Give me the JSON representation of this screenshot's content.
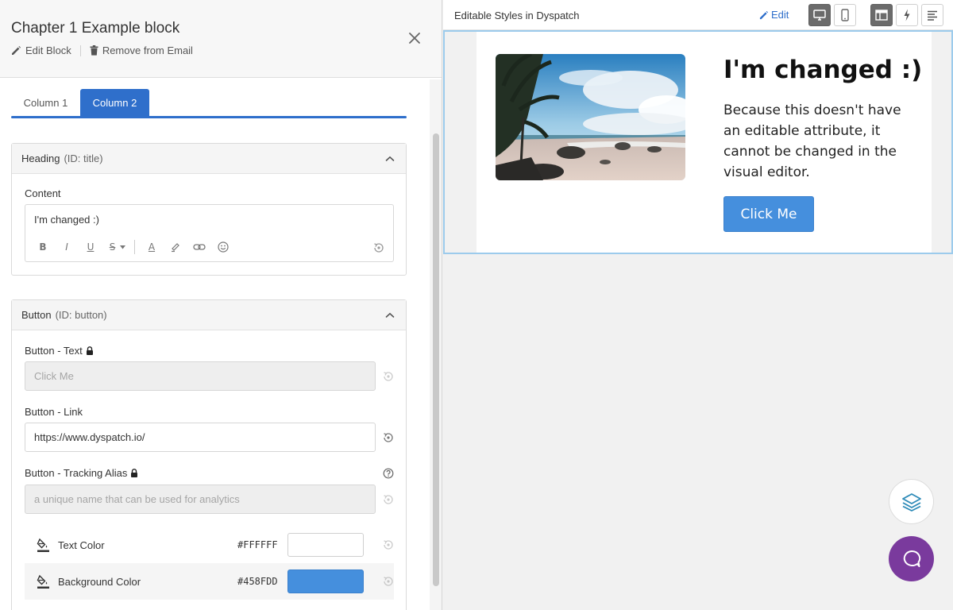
{
  "editor": {
    "title": "Chapter 1 Example block",
    "edit_block_label": "Edit Block",
    "remove_label": "Remove from Email",
    "tabs": [
      {
        "label": "Column 1",
        "active": false
      },
      {
        "label": "Column 2",
        "active": true
      }
    ],
    "heading_section": {
      "title": "Heading",
      "id_label": "(ID: title)",
      "content_label": "Content",
      "content_value": "I'm changed :)",
      "toolbar": {
        "bold": "B",
        "italic": "I",
        "underline": "U",
        "strike": "S",
        "font_color": "A"
      }
    },
    "button_section": {
      "title": "Button",
      "id_label": "(ID: button)",
      "text_label": "Button - Text",
      "text_placeholder": "Click Me",
      "link_label": "Button - Link",
      "link_value": "https://www.dyspatch.io/",
      "tracking_label": "Button - Tracking Alias",
      "tracking_placeholder": "a unique name that can be used for analytics",
      "text_color_label": "Text Color",
      "text_color_hex": "#FFFFFF",
      "bg_color_label": "Background Color",
      "bg_color_hex": "#458FDD"
    }
  },
  "preview": {
    "title": "Editable Styles in Dyspatch",
    "edit_label": "Edit",
    "email": {
      "heading": "I'm changed :)",
      "body": "Because this doesn't have an editable attribute, it cannot be changed in the visual editor.",
      "button_label": "Click Me"
    }
  },
  "colors": {
    "accent": "#2f6fcb",
    "button_bg": "#458FDD",
    "chat_bubble": "#7a3a9d",
    "preview_border": "#9ccbec"
  },
  "icons": [
    "pencil-icon",
    "trash-icon",
    "close-icon",
    "chevron-up-icon",
    "lock-icon",
    "reset-icon",
    "help-icon",
    "paint-bucket-icon",
    "desktop-icon",
    "mobile-icon",
    "layout-icon",
    "lightning-icon",
    "text-align-icon",
    "layers-icon",
    "chat-icon"
  ]
}
